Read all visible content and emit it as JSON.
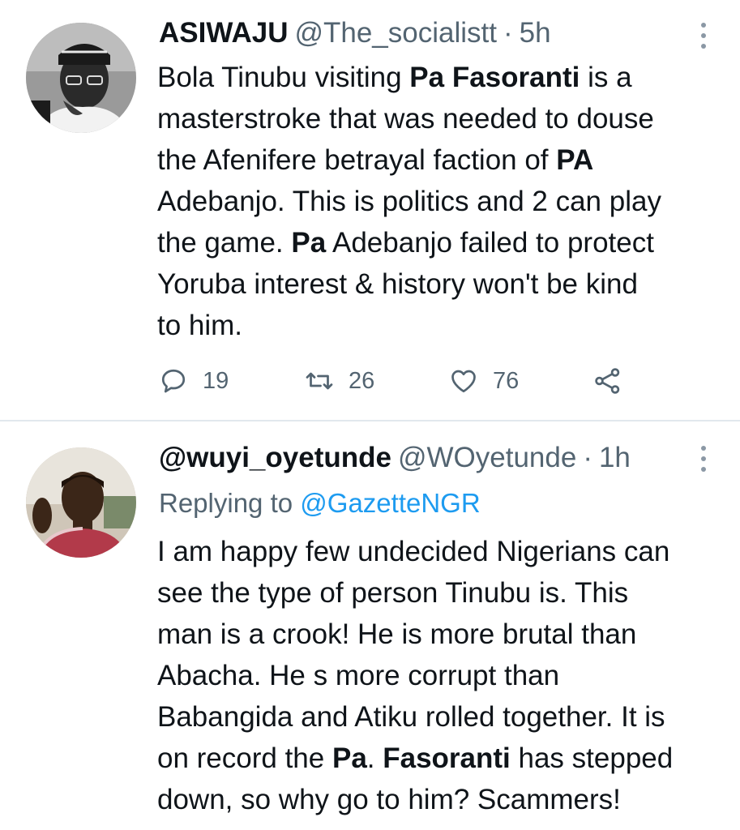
{
  "tweets": [
    {
      "display_name": "ASIWAJU",
      "handle": "@The_socialistt",
      "separator": "·",
      "time": "5h",
      "body_lines": [
        [
          {
            "t": "Bola Tinubu visiting "
          },
          {
            "t": "Pa Fasoranti",
            "b": true
          },
          {
            "t": " is a"
          }
        ],
        [
          {
            "t": "masterstroke that was needed to douse"
          }
        ],
        [
          {
            "t": "the Afenifere betrayal faction of "
          },
          {
            "t": "PA",
            "b": true
          }
        ],
        [
          {
            "t": "Adebanjo. This is politics and 2 can play"
          }
        ],
        [
          {
            "t": "the game. "
          },
          {
            "t": "Pa",
            "b": true
          },
          {
            "t": " Adebanjo failed to protect"
          }
        ],
        [
          {
            "t": "Yoruba interest & history won't be kind"
          }
        ],
        [
          {
            "t": "to him."
          }
        ]
      ],
      "stats": {
        "replies": "19",
        "retweets": "26",
        "likes": "76"
      },
      "icons": {
        "reply": "reply-icon",
        "retweet": "retweet-icon",
        "like": "heart-icon",
        "share": "share-icon",
        "more": "more-vertical-icon"
      }
    },
    {
      "display_name": "@wuyi_oyetunde",
      "handle": "@WOyetunde",
      "separator": "·",
      "time": "1h",
      "replying_prefix": "Replying to",
      "replying_to": "@GazetteNGR",
      "body_lines": [
        [
          {
            "t": "I am happy few undecided Nigerians can"
          }
        ],
        [
          {
            "t": "see the type of person Tinubu is. This"
          }
        ],
        [
          {
            "t": "man is a crook! He is more brutal than"
          }
        ],
        [
          {
            "t": "Abacha. He s more corrupt than"
          }
        ],
        [
          {
            "t": "Babangida and Atiku rolled together. It is"
          }
        ],
        [
          {
            "t": "on record the "
          },
          {
            "t": "Pa",
            "b": true
          },
          {
            "t": ". "
          },
          {
            "t": "Fasoranti",
            "b": true
          },
          {
            "t": " has stepped"
          }
        ],
        [
          {
            "t": "down, so why go to him? Scammers!"
          }
        ]
      ],
      "icons": {
        "more": "more-vertical-icon"
      }
    }
  ],
  "colors": {
    "text": "#0f1419",
    "secondary": "#536471",
    "link": "#1d9bf0",
    "divider": "#e1e8ed"
  }
}
